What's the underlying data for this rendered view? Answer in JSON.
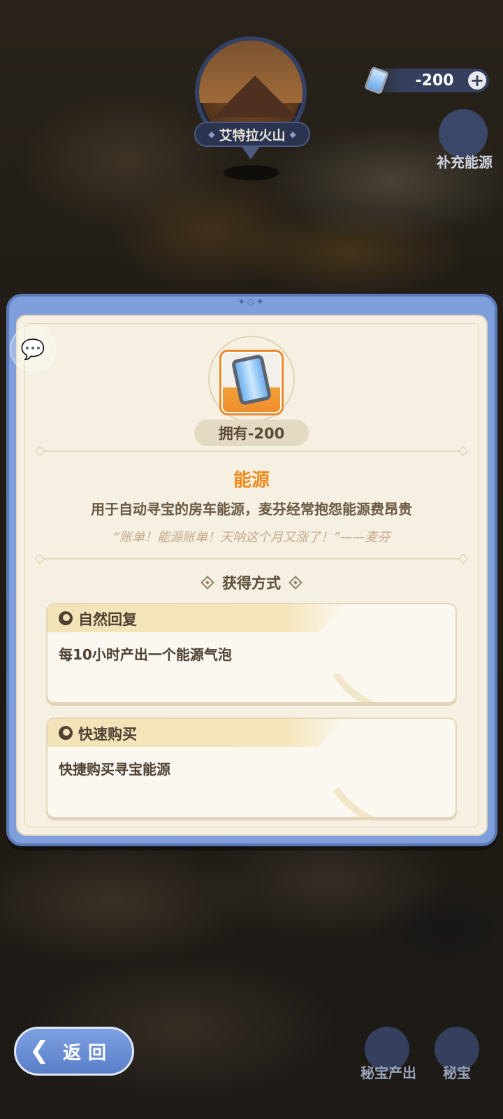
{
  "location": {
    "name": "艾特拉火山"
  },
  "energy": {
    "amount": "-200",
    "add_label": "+",
    "supplement_label": "补充能源"
  },
  "item": {
    "own_label": "拥有-200",
    "name": "能源",
    "description": "用于自动寻宝的房车能源，麦芬经常抱怨能源费昂贵",
    "quote": "“账单！能源账单！天呐这个月又涨了！”——麦芬"
  },
  "obtain": {
    "heading": "获得方式",
    "methods": [
      {
        "title": "自然回复",
        "desc": "每10小时产出一个能源气泡"
      },
      {
        "title": "快速购买",
        "desc": "快捷购买寻宝能源"
      }
    ]
  },
  "bottom": {
    "back_label": "返回",
    "treasure_output_label": "秘宝产出",
    "treasure_label": "秘宝"
  },
  "colors": {
    "accent": "#f08a1c",
    "frame": "#7f9fdc",
    "panel": "#f5f0e2"
  }
}
